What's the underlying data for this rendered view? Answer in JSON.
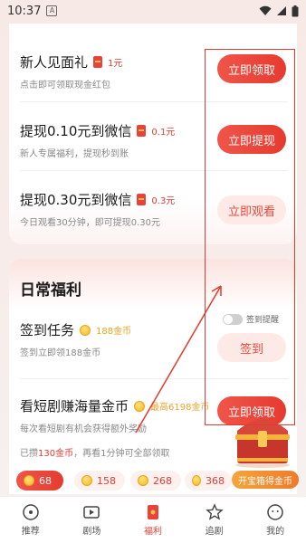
{
  "status": {
    "time": "10:37",
    "notif": "A"
  },
  "tasks": [
    {
      "title": "新人见面礼",
      "reward": "1元",
      "sub": "点击即可领取现金红包",
      "button": "立即领取"
    },
    {
      "title": "提现0.10元到微信",
      "reward": "0.1元",
      "sub": "新人专属福利，提现秒到账",
      "button": "立即提现"
    },
    {
      "title": "提现0.30元到微信",
      "reward": "0.3元",
      "sub": "今日观看30分钟，即可提现0.30元",
      "button": "立即观看"
    }
  ],
  "daily": {
    "section_title": "日常福利",
    "signin": {
      "title": "签到任务",
      "reward": "188金币",
      "sub": "签到立即领188金币",
      "toggle_label": "签到提醒",
      "button": "签到"
    },
    "watch": {
      "title": "看短剧赚海量金币",
      "reward": "最高6198金币",
      "sub": "每次看短剧有机会获得额外奖励",
      "button": "立即领取"
    },
    "progress": {
      "prefix": "已攒",
      "amount": "130金币",
      "suffix": "，再看1分钟可全部领取"
    },
    "pills": [
      "68",
      "158",
      "268",
      "368"
    ],
    "chest_button": "开宝箱得金币"
  },
  "tabbar": [
    {
      "label": "推荐",
      "icon": "recommend-icon",
      "active": false
    },
    {
      "label": "剧场",
      "icon": "theater-icon",
      "active": false
    },
    {
      "label": "福利",
      "icon": "welfare-icon",
      "active": true
    },
    {
      "label": "追剧",
      "icon": "follow-icon",
      "active": false
    },
    {
      "label": "我的",
      "icon": "profile-icon",
      "active": false
    }
  ],
  "colors": {
    "accent": "#e8423b",
    "gold": "#f0a32a",
    "annotation": "#e23a2c"
  }
}
